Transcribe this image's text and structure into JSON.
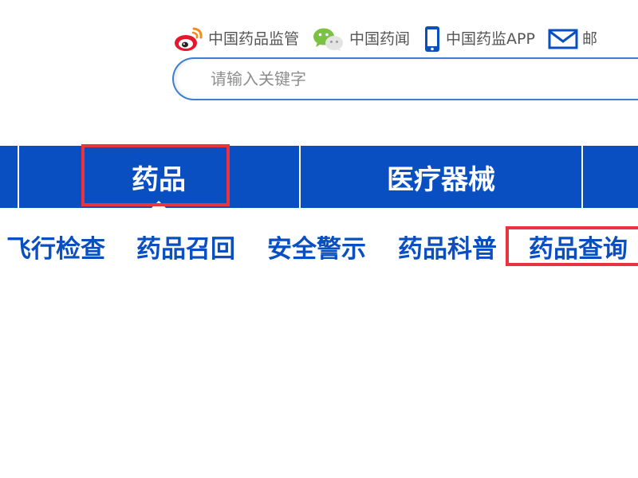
{
  "top_links": [
    {
      "label": "中国药品监管",
      "icon": "weibo-icon"
    },
    {
      "label": "中国药闻",
      "icon": "wechat-icon"
    },
    {
      "label": "中国药监APP",
      "icon": "mobile-phone-icon"
    },
    {
      "label": "邮",
      "icon": "mail-icon"
    }
  ],
  "search": {
    "placeholder": "请输入关键字",
    "value": ""
  },
  "main_nav": {
    "items": [
      {
        "label": "药品",
        "active": true
      },
      {
        "label": "医疗器械",
        "active": false
      }
    ]
  },
  "sub_nav": {
    "items": [
      {
        "label": "飞行检查"
      },
      {
        "label": "药品召回"
      },
      {
        "label": "安全警示"
      },
      {
        "label": "药品科普"
      },
      {
        "label": "药品查询"
      }
    ]
  },
  "colors": {
    "brand_blue": "#0a4fc2",
    "highlight_red": "#e8343f",
    "search_border": "#3a7fd5"
  }
}
